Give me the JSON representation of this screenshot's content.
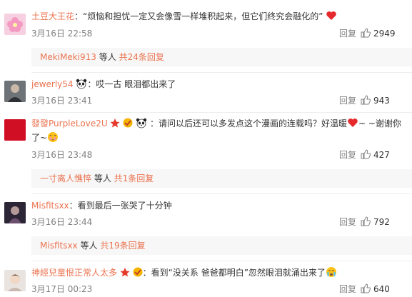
{
  "comments": [
    {
      "username": "土豆大王花",
      "text": "：“烦恼和担忧一定又会像雪一样堆积起来，但它们终究会融化的”",
      "time": "3月16日 22:58",
      "reply": "回复",
      "likes": "2949"
    },
    {
      "username": "jewerly54",
      "text": "：哎一古 眼泪都出来了",
      "time": "3月16日 23:41",
      "reply": "回复",
      "likes": "943"
    },
    {
      "username": "發發PurpleLove2U",
      "text_a": "：请问以后还可以多发点这个漫画的连载吗？好温暖",
      "text_b": "~ ~谢谢你了~",
      "time": "3月16日 23:48",
      "reply": "回复",
      "likes": "427"
    },
    {
      "username": "Misfitsxx",
      "text": "：看到最后一张哭了十分钟",
      "time": "3月16日 23:44",
      "reply": "回复",
      "likes": "792"
    },
    {
      "username": "神經兒童恨正常人太多",
      "text_a": "：看到“没关系 爸爸都明白”忽然眼泪就涌出来了",
      "time": "3月17日 00:23",
      "reply": "回复",
      "likes": "640"
    }
  ],
  "replies": [
    {
      "user": "MekiMeki913",
      "mid": " 等人 ",
      "count": "共24条回复"
    },
    {
      "user": "一寸离人憔悴",
      "mid": " 等人 ",
      "count": "共1条回复"
    },
    {
      "user": "Misfitsxx",
      "mid": " 等人 ",
      "count": "共19条回复"
    }
  ],
  "colors": {
    "accent": "#eb7350",
    "meta": "#808080",
    "reply_bg": "#f7f7f7"
  },
  "icons": [
    "thumbs-up-icon",
    "heart-emoji",
    "panda-emoji",
    "crown-badge",
    "gold-badge",
    "blush-emoji",
    "crying-emoji"
  ]
}
